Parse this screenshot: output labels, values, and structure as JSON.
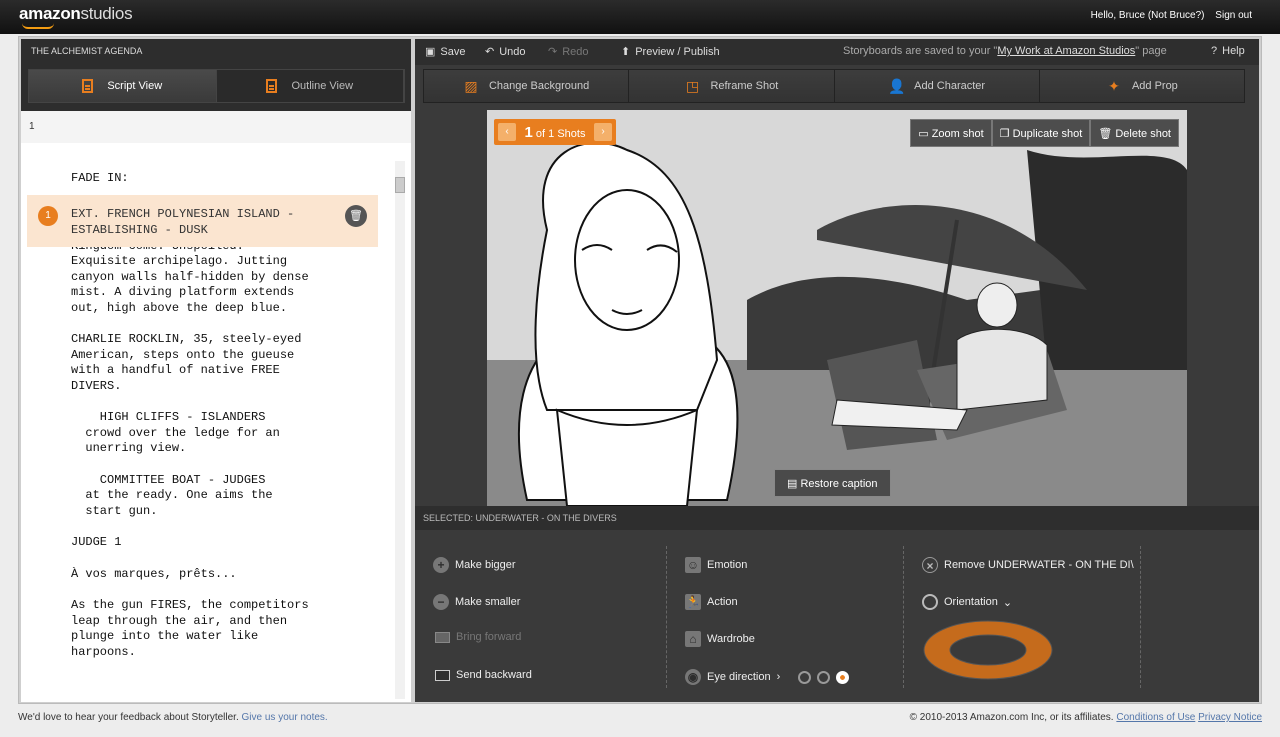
{
  "header": {
    "logo_bold": "amazon",
    "logo_light": "studios",
    "greeting": "Hello, Bruce (Not Bruce?)",
    "sign_out": "Sign out"
  },
  "left": {
    "project_title": "THE ALCHEMIST AGENDA",
    "tabs": [
      {
        "label": "Script View",
        "active": true
      },
      {
        "label": "Outline View",
        "active": false
      }
    ],
    "page_number": "1",
    "script_blocks": [
      "FADE IN:",
      "Kingdom come. Unspoiled.\nExquisite archipelago. Jutting\ncanyon walls half-hidden by dense\nmist. A diving platform extends\nout, high above the deep blue.",
      "CHARLIE ROCKLIN, 35, steely-eyed\nAmerican, steps onto the gueuse\nwith a handful of native FREE\nDIVERS.",
      "    HIGH CLIFFS - ISLANDERS\n  crowd over the ledge for an\n  unerring view.",
      "    COMMITTEE BOAT - JUDGES\n  at the ready. One aims the\n  start gun.",
      "JUDGE 1",
      "À vos marques, prêts...",
      "As the gun FIRES, the competitors\nleap through the air, and then\nplunge into the water like\nharpoons."
    ],
    "scene": {
      "number": "1",
      "heading": "EXT. FRENCH POLYNESIAN ISLAND -\nESTABLISHING - DUSK"
    }
  },
  "toolbar": {
    "save": "Save",
    "undo": "Undo",
    "redo": "Redo",
    "preview": "Preview / Publish",
    "saved_prefix": "Storyboards are saved to your \"",
    "saved_link": "My Work at Amazon Studios",
    "saved_suffix": "\" page",
    "help": "Help"
  },
  "tools": [
    "Change Background",
    "Reframe Shot",
    "Add Character",
    "Add Prop"
  ],
  "stage": {
    "shot_current": "1",
    "shot_total": "of 1 Shots",
    "zoom": "Zoom shot",
    "duplicate": "Duplicate shot",
    "delete": "Delete shot",
    "restore_caption": "Restore caption"
  },
  "selected": "Selected: UNDERWATER - ON THE DIVERS",
  "controls": {
    "make_bigger": "Make bigger",
    "make_smaller": "Make smaller",
    "bring_forward": "Bring forward",
    "send_backward": "Send backward",
    "emotion": "Emotion",
    "action": "Action",
    "wardrobe": "Wardrobe",
    "eye_direction": "Eye direction",
    "remove": "Remove UNDERWATER - ON THE DI\\",
    "orientation": "Orientation"
  },
  "footer": {
    "feedback": "We'd love to hear your feedback about Storyteller.",
    "feedback_link": "Give us your notes.",
    "copyright": "© 2010-2013 Amazon.com Inc, or its affiliates.",
    "conditions": "Conditions of Use",
    "privacy": "Privacy Notice"
  },
  "colors": {
    "accent": "#e87e1f",
    "dark": "#2e2e2e"
  }
}
